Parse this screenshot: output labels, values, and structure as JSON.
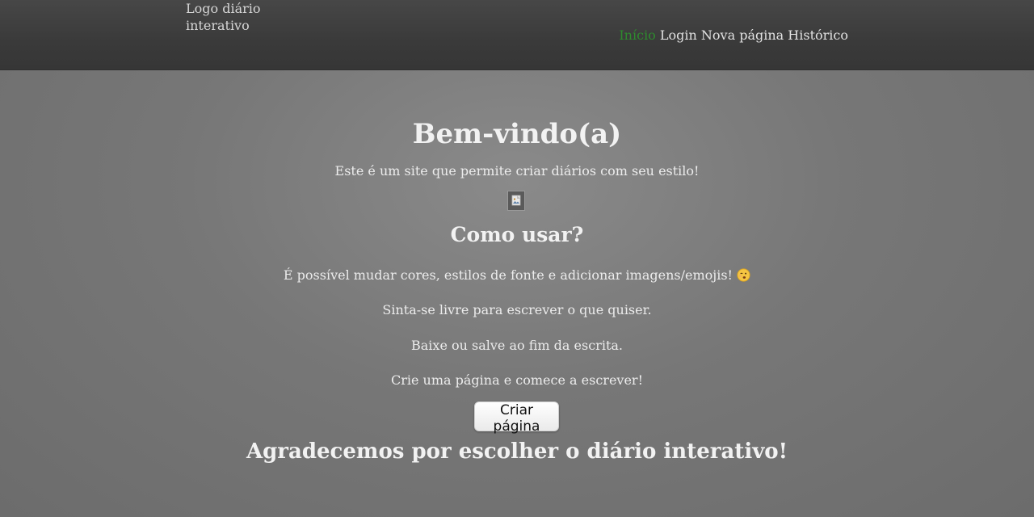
{
  "header": {
    "logo_text": "Logo diário interativo",
    "nav": [
      {
        "label": "Início"
      },
      {
        "label": "Login"
      },
      {
        "label": "Nova página"
      },
      {
        "label": "Histórico"
      }
    ],
    "active_color": "#2e8b2e"
  },
  "main": {
    "title": "Bem-vindo(a)",
    "intro": "Este é um site que permite criar diários com seu estilo!",
    "image_icon": "broken-image-icon",
    "how_title": "Como usar?",
    "steps": [
      "É possível mudar cores, estilos de fonte e adicionar imagens/emojis!",
      "Sinta-se livre para escrever o que quiser.",
      "Baixe ou salve ao fim da escrita.",
      "Crie uma página e comece a escrever!"
    ],
    "emoji_icon": "winking-face-emoji",
    "create_button": "Criar página",
    "thanks": "Agradecemos por escolher o diário interativo!"
  }
}
